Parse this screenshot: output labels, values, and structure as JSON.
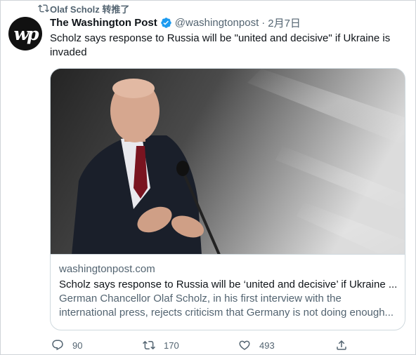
{
  "retweet_banner": {
    "text": "Olaf Scholz 转推了",
    "icon": "retweet-icon"
  },
  "tweet": {
    "author_name": "The Washington Post",
    "author_handle": "@washingtonpost",
    "separator": "·",
    "date": "2月7日",
    "avatar_text": "wp",
    "verified_icon": "verified-badge-icon",
    "text": "Scholz says response to Russia will be \"united and decisive\" if Ukraine is invaded"
  },
  "card": {
    "image_icon": "photo-of-speaker-at-microphone",
    "domain": "washingtonpost.com",
    "title": "Scholz says response to Russia will be ‘united and decisive’ if Ukraine ...",
    "description": "German Chancellor Olaf Scholz, in his first interview with the international press, rejects criticism that Germany is not doing enough..."
  },
  "actions": {
    "reply_count": "90",
    "retweet_count": "170",
    "like_count": "493",
    "reply_icon": "reply-icon",
    "retweet_icon": "retweet-icon",
    "like_icon": "heart-icon",
    "share_icon": "share-icon"
  },
  "colors": {
    "text_primary": "#0f1419",
    "text_secondary": "#536471",
    "verified_blue": "#1d9bf0",
    "border": "#cfd9de"
  }
}
